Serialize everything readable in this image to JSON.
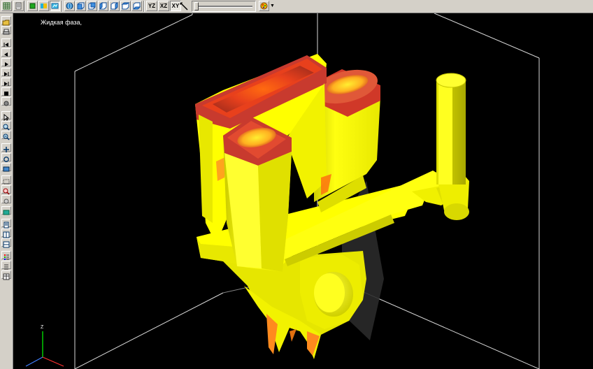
{
  "toolbar": {
    "plane_buttons": [
      "YZ",
      "XZ",
      "XY"
    ],
    "active_plane": "XY"
  },
  "viewport": {
    "phase_label": "Жидкая фаза,",
    "axis_label": "Z",
    "colors": {
      "background": "#000000",
      "solid": "#ffff00",
      "liquid_core": "#e8401c",
      "mushy": "#ff8a1e",
      "bounding_box": "#ffffff"
    }
  },
  "icons": {
    "top": [
      "grid-icon",
      "cube-green-icon",
      "cube-palette-icon",
      "cube-view-icon",
      "globe-icon",
      "view-front-icon",
      "view-back-icon",
      "view-left-icon",
      "view-right-icon",
      "view-top-icon",
      "view-bottom-icon",
      "measure-icon",
      "palette-icon",
      "dropdown-icon"
    ],
    "left": [
      "open-icon",
      "print-icon",
      "first-frame-icon",
      "prev-frame-icon",
      "play-icon",
      "next-frame-icon",
      "last-frame-icon",
      "stop-icon",
      "record-icon",
      "select-icon",
      "zoom-in-icon",
      "zoom-out-icon",
      "pan-icon",
      "rotate-icon",
      "section-icon",
      "box-icon",
      "probe-icon",
      "settings-icon",
      "color-icon",
      "document-icon",
      "layout-vertical-icon",
      "layout-horizontal-icon",
      "legend-icon",
      "list-icon"
    ]
  }
}
